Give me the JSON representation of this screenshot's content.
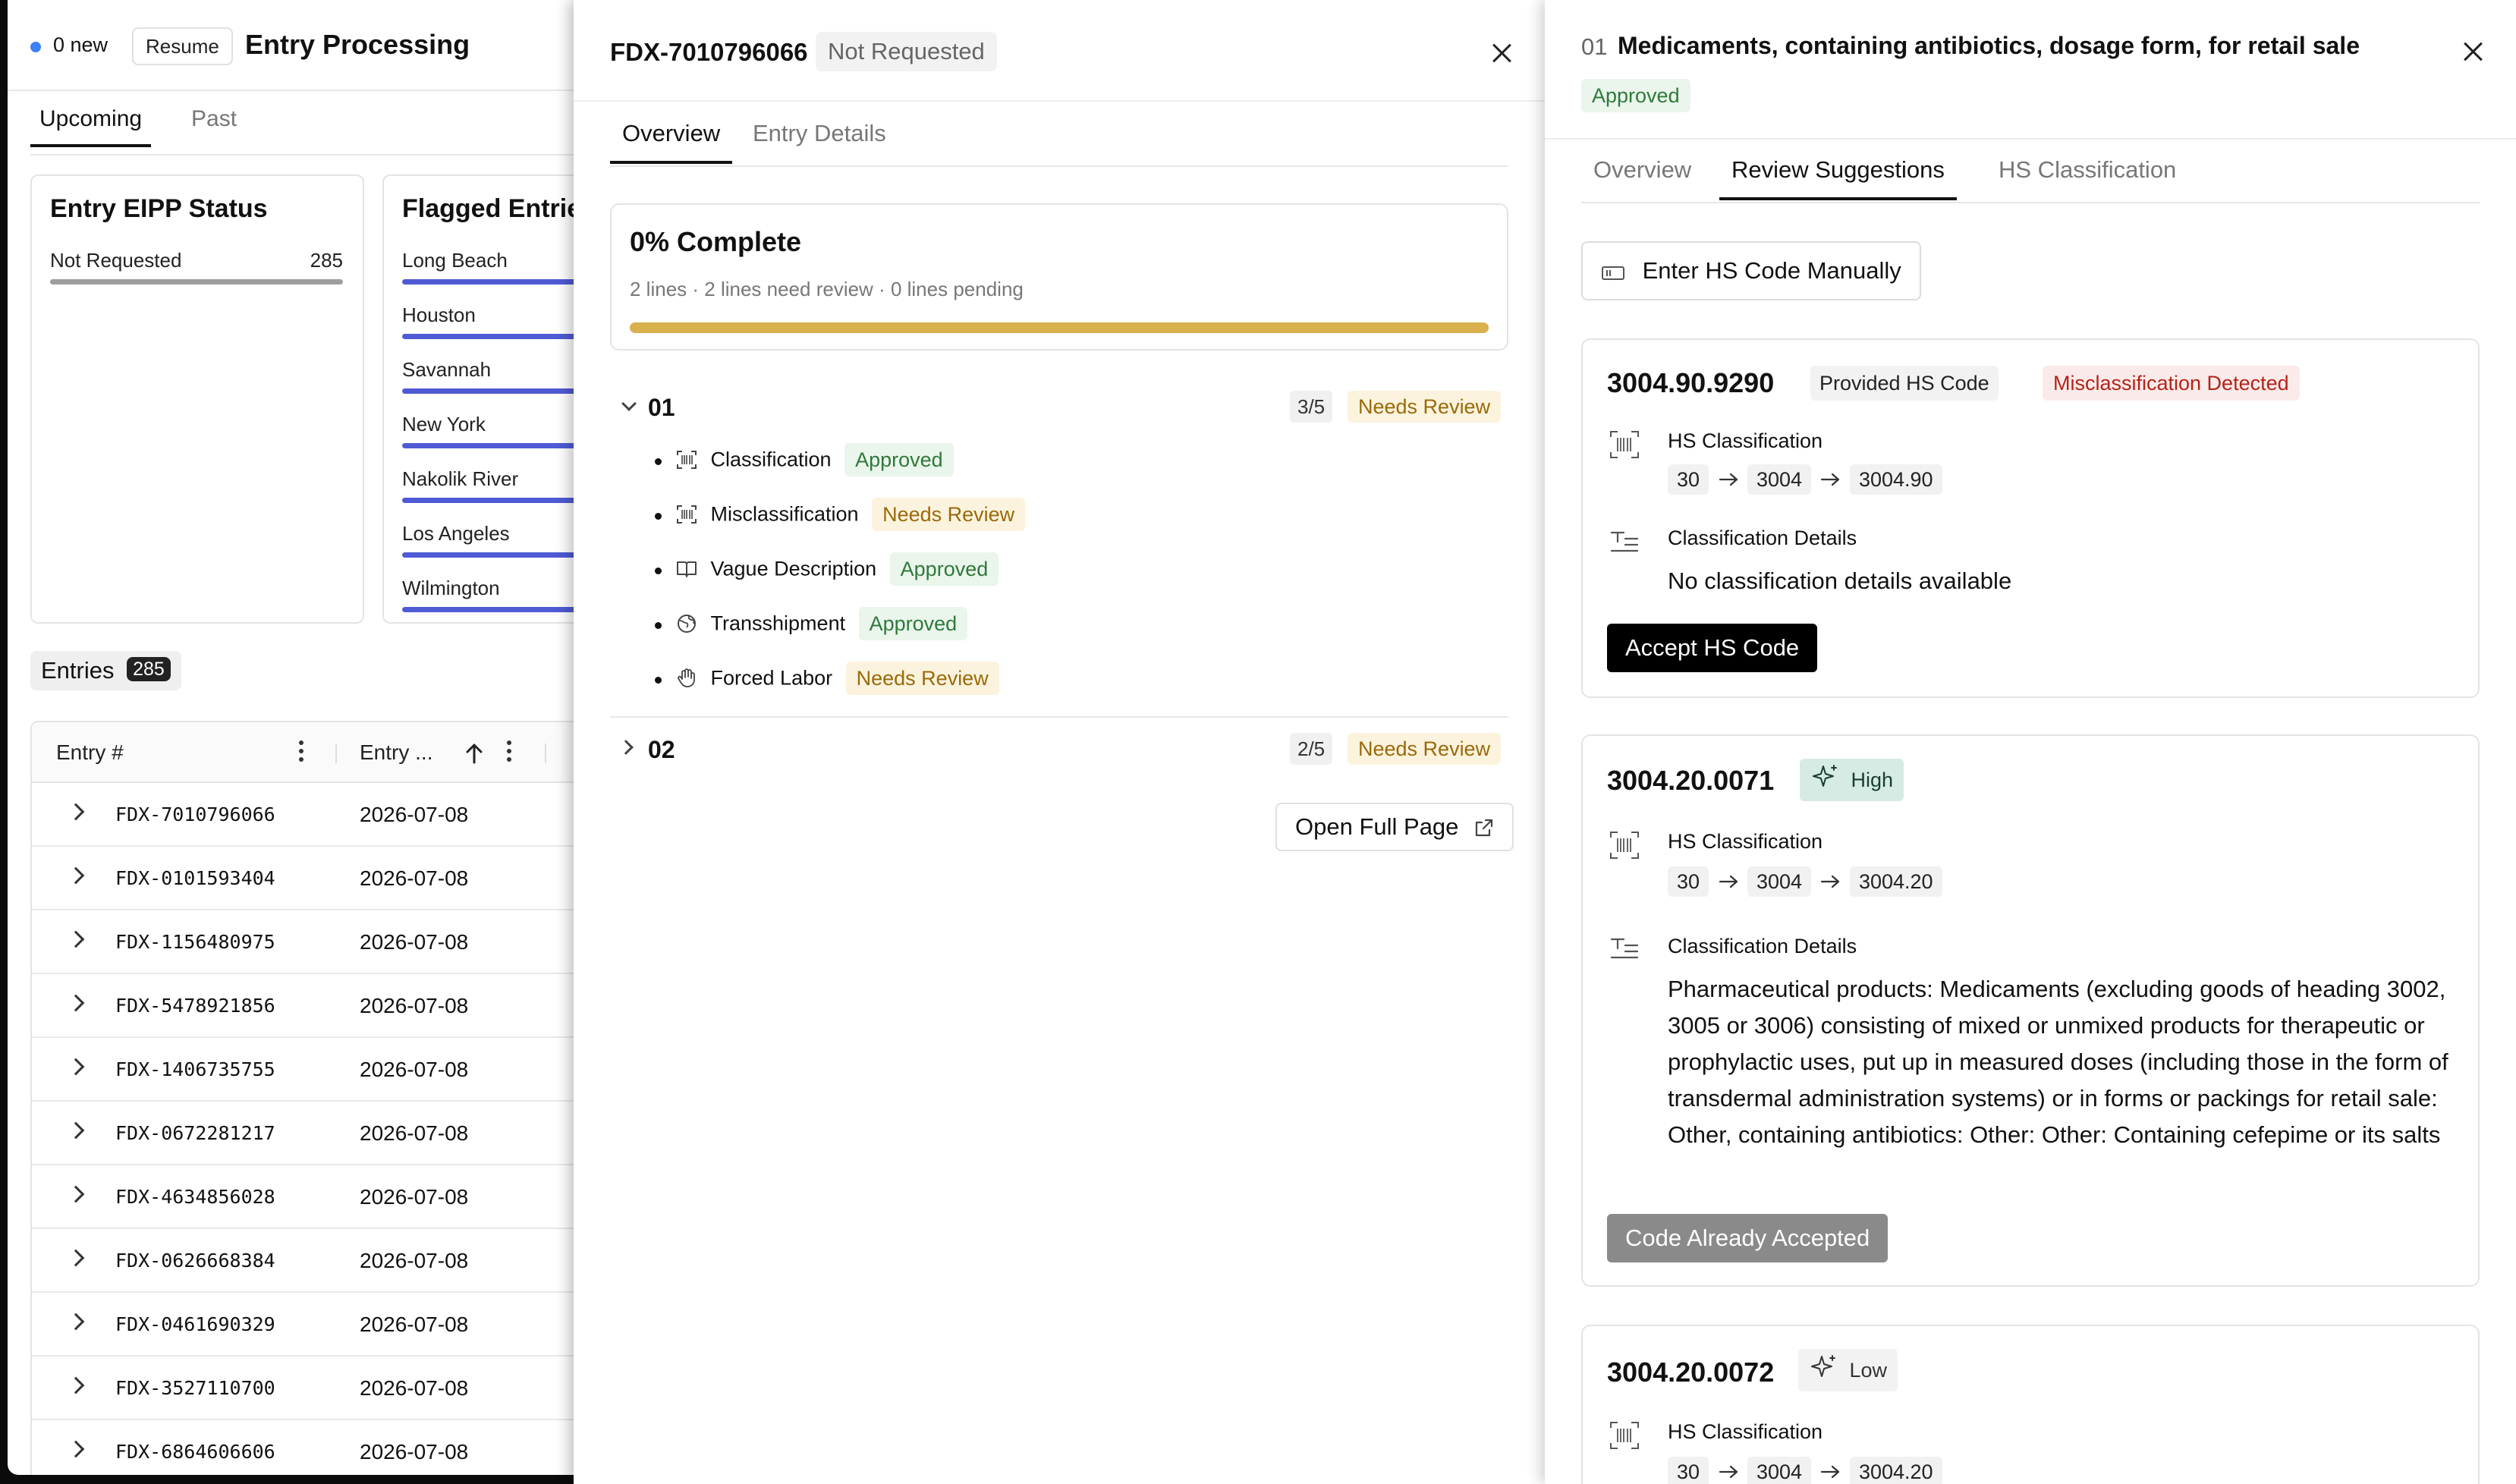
{
  "base": {
    "new_count": "0 new",
    "resume_label": "Resume",
    "app_title": "Entry Processing",
    "tabs": [
      "Upcoming",
      "Past"
    ],
    "eipp_card": {
      "title": "Entry EIPP Status",
      "rows": [
        {
          "label": "Not Requested",
          "value": "285"
        }
      ]
    },
    "flagged_card": {
      "title": "Flagged Entries",
      "ports": [
        "Long Beach",
        "Houston",
        "Savannah",
        "New York",
        "Nakolik River",
        "Los Angeles",
        "Wilmington"
      ]
    },
    "entries_label": "Entries",
    "entries_count": "285",
    "table": {
      "columns": [
        "Entry #",
        "Entry ..."
      ],
      "rows": [
        {
          "id": "FDX-7010796066",
          "date": "2026-07-08"
        },
        {
          "id": "FDX-0101593404",
          "date": "2026-07-08"
        },
        {
          "id": "FDX-1156480975",
          "date": "2026-07-08"
        },
        {
          "id": "FDX-5478921856",
          "date": "2026-07-08"
        },
        {
          "id": "FDX-1406735755",
          "date": "2026-07-08"
        },
        {
          "id": "FDX-0672281217",
          "date": "2026-07-08"
        },
        {
          "id": "FDX-4634856028",
          "date": "2026-07-08"
        },
        {
          "id": "FDX-0626668384",
          "date": "2026-07-08"
        },
        {
          "id": "FDX-0461690329",
          "date": "2026-07-08"
        },
        {
          "id": "FDX-3527110700",
          "date": "2026-07-08"
        },
        {
          "id": "FDX-6864606606",
          "date": "2026-07-08"
        }
      ]
    }
  },
  "entry": {
    "id": "FDX-7010796066",
    "status": "Not Requested",
    "tabs": [
      "Overview",
      "Entry Details"
    ],
    "progress": {
      "title": "0% Complete",
      "subtitle": "2 lines · 2 lines need review · 0 lines pending",
      "percent": 0
    },
    "lines": [
      {
        "num": "01",
        "fraction": "3/5",
        "status": "Needs Review",
        "checks": [
          {
            "label": "Classification",
            "status": "Approved",
            "icon": "barcode-icon"
          },
          {
            "label": "Misclassification",
            "status": "Needs Review",
            "icon": "barcode-icon"
          },
          {
            "label": "Vague Description",
            "status": "Approved",
            "icon": "book-icon"
          },
          {
            "label": "Transshipment",
            "status": "Approved",
            "icon": "globe-icon"
          },
          {
            "label": "Forced Labor",
            "status": "Needs Review",
            "icon": "hand-icon"
          }
        ]
      },
      {
        "num": "02",
        "fraction": "2/5",
        "status": "Needs Review"
      }
    ],
    "open_full_page": "Open Full Page"
  },
  "line_detail": {
    "num": "01",
    "title": "Medicaments, containing antibiotics, dosage form, for retail sale",
    "status": "Approved",
    "tabs": [
      "Overview",
      "Review Suggestions",
      "HS Classification"
    ],
    "manual_button": "Enter HS Code Manually",
    "suggestions": [
      {
        "code": "3004.90.9290",
        "tags": [
          "Provided HS Code",
          "Misclassification Detected"
        ],
        "hs_label": "HS Classification",
        "path": [
          "30",
          "3004",
          "3004.90"
        ],
        "details_label": "Classification Details",
        "details": "No classification details available",
        "button": "Accept HS Code"
      },
      {
        "code": "3004.20.0071",
        "confidence": "High",
        "hs_label": "HS Classification",
        "path": [
          "30",
          "3004",
          "3004.20"
        ],
        "details_label": "Classification Details",
        "details": "Pharmaceutical products: Medicaments (excluding goods of heading 3002, 3005 or 3006) consisting of mixed or unmixed products for therapeutic or prophylactic uses, put up in measured doses (including those in the form of transdermal administration systems) or in forms or packings for retail sale: Other, containing antibiotics: Other: Other: Containing cefepime or its salts",
        "button": "Code Already Accepted"
      },
      {
        "code": "3004.20.0072",
        "confidence": "Low",
        "hs_label": "HS Classification",
        "path": [
          "30",
          "3004",
          "3004.20"
        ]
      }
    ]
  },
  "colors": {
    "accent_blue": "#3b82f6",
    "flag_bar": "#4f5bd5",
    "progress_bar": "#d8b04e",
    "approved_bg": "#eaf5ec",
    "needs_review_bg": "#fbf3dd",
    "misclassification_red": "#b42318",
    "high_confidence_bg": "#d6ebe4"
  }
}
